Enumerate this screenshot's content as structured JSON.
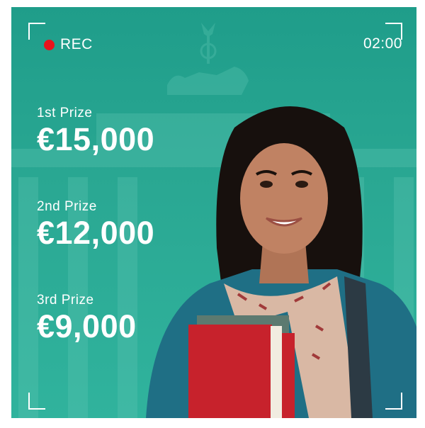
{
  "recording": {
    "label": "REC",
    "timer": "02:00"
  },
  "prizes": [
    {
      "label": "1st Prize",
      "amount": "€15,000"
    },
    {
      "label": "2nd Prize",
      "amount": "€12,000"
    },
    {
      "label": "3rd Prize",
      "amount": "€9,000"
    }
  ],
  "colors": {
    "background": "#2aa893",
    "rec_dot": "#e8141b",
    "text": "#ffffff"
  }
}
